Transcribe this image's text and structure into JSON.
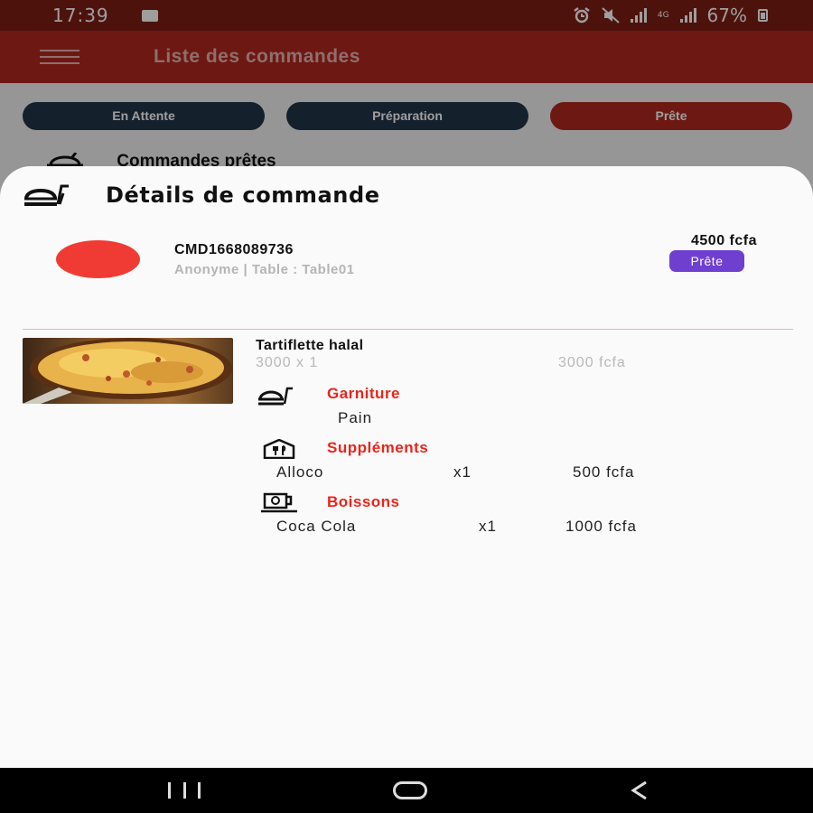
{
  "status_bar": {
    "time": "17:39",
    "fourg": "4G",
    "battery": "67%"
  },
  "app_bar": {
    "title": "Liste des commandes"
  },
  "tabs": [
    {
      "label": "En Attente"
    },
    {
      "label": "Préparation"
    },
    {
      "label": "Prête"
    }
  ],
  "background_section": {
    "title": "Commandes prêtes"
  },
  "sheet": {
    "title": "Détails de commande",
    "order": {
      "code": "CMD1668089736",
      "meta": "Anonyme | Table : Table01",
      "total": "4500 fcfa",
      "status": "Prête"
    },
    "item": {
      "name": "Tartiflette halal",
      "qty": "3000 x 1",
      "price": "3000 fcfa"
    },
    "garniture": {
      "title": "Garniture",
      "items": [
        "Pain"
      ]
    },
    "supplements": {
      "title": "Suppléments",
      "items": [
        {
          "name": "Alloco",
          "qty": "x1",
          "price": "500 fcfa"
        }
      ]
    },
    "boissons": {
      "title": "Boissons",
      "items": [
        {
          "name": "Coca Cola",
          "qty": "x1",
          "price": "1000 fcfa"
        }
      ]
    }
  },
  "colors": {
    "primary": "#b0281f",
    "dark_tab": "#23344a",
    "status_dot": "#ef3b33",
    "badge": "#6f3fd0",
    "section_title": "#e8251c"
  }
}
